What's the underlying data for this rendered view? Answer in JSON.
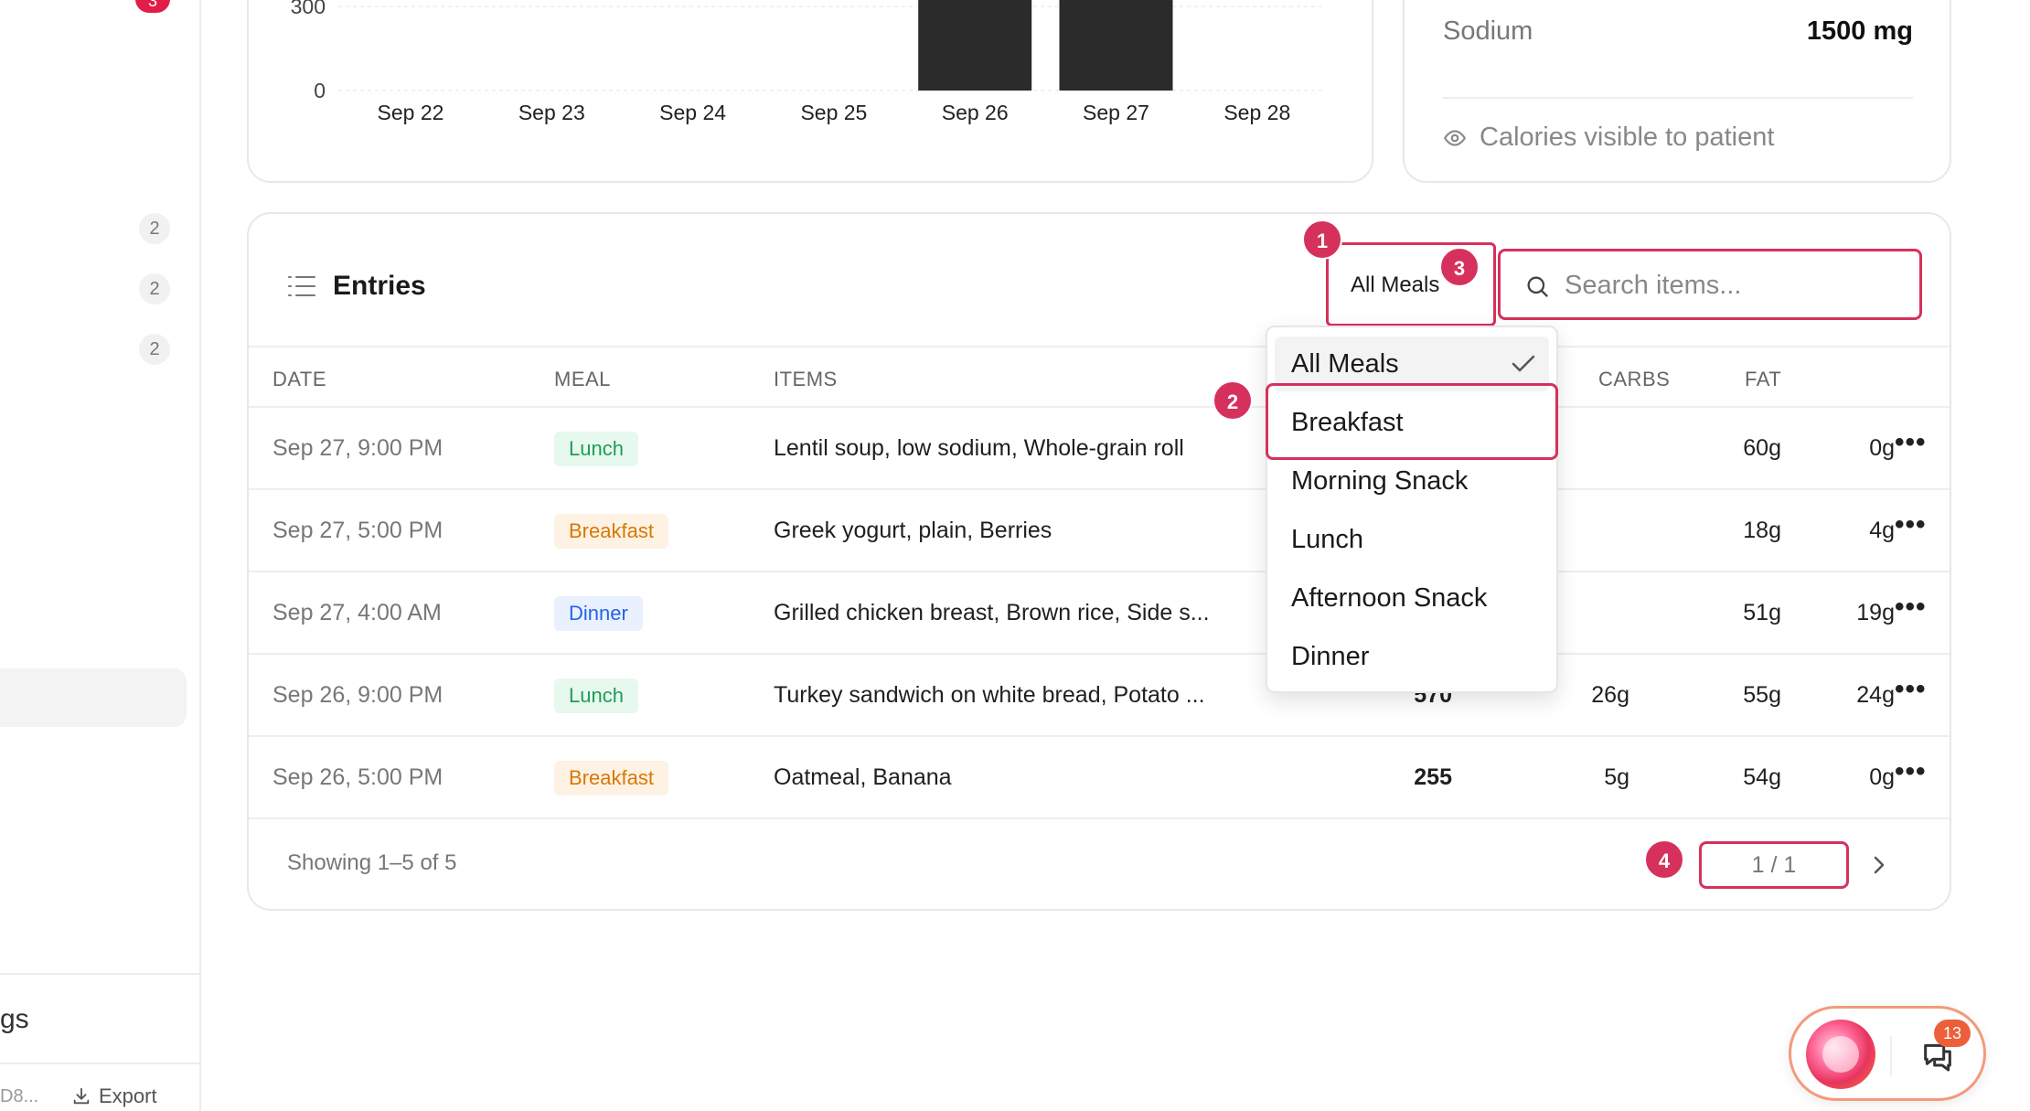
{
  "sidebar": {
    "top_badge": "3",
    "counts": [
      "2",
      "2",
      "2"
    ],
    "settings_fragment": "gs",
    "footer_id_fragment": "D8...",
    "export_label": "Export"
  },
  "chart_data": {
    "type": "bar",
    "categories": [
      "Sep 22",
      "Sep 23",
      "Sep 24",
      "Sep 25",
      "Sep 26",
      "Sep 27",
      "Sep 28"
    ],
    "values": [
      0,
      0,
      0,
      0,
      330,
      330,
      0
    ],
    "y_ticks": [
      "0",
      "300"
    ],
    "ylim": [
      0,
      330
    ],
    "grid": true,
    "bar_color": "#2b2b2b"
  },
  "nutrition": {
    "sodium_label": "Sodium",
    "sodium_value": "1500 mg",
    "visibility_text": "Calories visible to patient"
  },
  "entries": {
    "title": "Entries",
    "filter_value": "All Meals",
    "search_placeholder": "Search items...",
    "columns": {
      "date": "DATE",
      "meal": "MEAL",
      "items": "ITEMS",
      "carbs": "CARBS",
      "fat": "FAT"
    },
    "rows": [
      {
        "date": "Sep 27, 9:00 PM",
        "meal": "Lunch",
        "meal_type": "lunch",
        "items": "Lentil soup, low sodium, Whole-grain roll",
        "calories": "",
        "protein": "",
        "carbs": "60g",
        "fat": "0g"
      },
      {
        "date": "Sep 27, 5:00 PM",
        "meal": "Breakfast",
        "meal_type": "breakfast",
        "items": "Greek yogurt, plain, Berries",
        "calories": "",
        "protein": "",
        "carbs": "18g",
        "fat": "4g"
      },
      {
        "date": "Sep 27, 4:00 AM",
        "meal": "Dinner",
        "meal_type": "dinner",
        "items": "Grilled chicken breast, Brown rice, Side s...",
        "calories": "",
        "protein": "",
        "carbs": "51g",
        "fat": "19g"
      },
      {
        "date": "Sep 26, 9:00 PM",
        "meal": "Lunch",
        "meal_type": "lunch",
        "items": "Turkey sandwich on white bread, Potato ...",
        "calories": "570",
        "protein": "26g",
        "carbs": "55g",
        "fat": "24g"
      },
      {
        "date": "Sep 26, 5:00 PM",
        "meal": "Breakfast",
        "meal_type": "breakfast",
        "items": "Oatmeal, Banana",
        "calories": "255",
        "protein": "5g",
        "carbs": "54g",
        "fat": "0g"
      }
    ],
    "showing": "Showing 1–5 of 5",
    "pager": "1 / 1"
  },
  "dropdown": {
    "options": [
      "All Meals",
      "Breakfast",
      "Morning Snack",
      "Lunch",
      "Afternoon Snack",
      "Dinner"
    ],
    "selected": "All Meals"
  },
  "markers": [
    "1",
    "2",
    "3",
    "4"
  ],
  "chat": {
    "count": "13"
  },
  "colors": {
    "accent": "#d6315c",
    "lunch": "#1f9d55",
    "breakfast": "#d97706",
    "dinner": "#2563eb"
  }
}
